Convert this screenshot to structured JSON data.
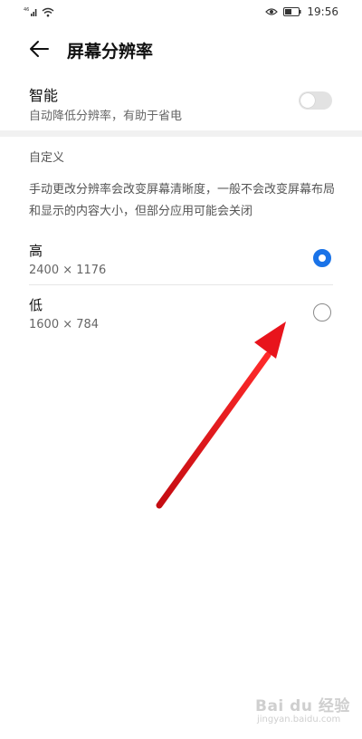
{
  "status_bar": {
    "signal_label": "46",
    "time": "19:56",
    "icons": [
      "signal-icon",
      "wifi-icon",
      "eye-icon",
      "battery-icon"
    ]
  },
  "header": {
    "title": "屏幕分辨率",
    "back_icon": "back-arrow-icon"
  },
  "smart": {
    "title": "智能",
    "description": "自动降低分辨率，有助于省电",
    "enabled": false
  },
  "custom": {
    "section_label": "自定义",
    "description": "手动更改分辨率会改变屏幕清晰度，一般不会改变屏幕布局和显示的内容大小，但部分应用可能会关闭",
    "options": [
      {
        "label": "高",
        "value": "2400 × 1176",
        "selected": true
      },
      {
        "label": "低",
        "value": "1600 × 784",
        "selected": false
      }
    ]
  },
  "colors": {
    "accent": "#1a73e8",
    "annotation_arrow": "#e8141c"
  },
  "watermark": {
    "logo": "Bai du 经验",
    "url": "jingyan.baidu.com"
  }
}
